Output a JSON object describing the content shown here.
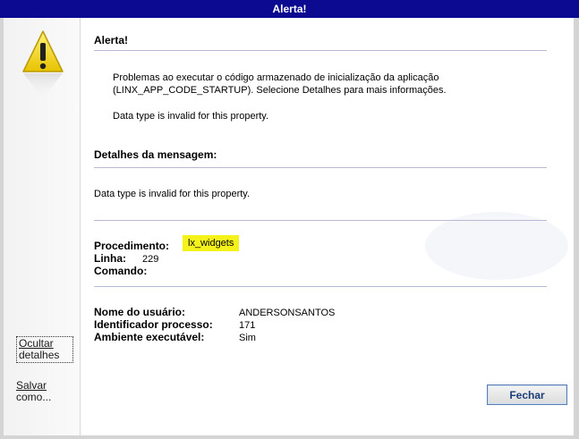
{
  "window": {
    "title": "Alerta!"
  },
  "sidebar": {
    "hide_details_line1": "Ocultar",
    "hide_details_line2": "detalhes",
    "save_as_line1": "Salvar",
    "save_as_line2": "como..."
  },
  "alert": {
    "heading": "Alerta!",
    "message_line1": "Problemas ao executar o código armazenado de inicialização da aplicação",
    "message_line2": "(LINX_APP_CODE_STARTUP). Selecione Detalhes para mais informações.",
    "message_line3": "Data type is invalid for this property."
  },
  "details": {
    "heading": "Detalhes da mensagem:",
    "message": "Data type is invalid for this property.",
    "procedure_label": "Procedimento:",
    "procedure_value": "lx_widgets",
    "line_label": "Linha:",
    "line_value": "229",
    "command_label": "Comando:",
    "command_value": ""
  },
  "session": {
    "user_label": "Nome do usuário:",
    "user_value": "ANDERSONSANTOS",
    "process_label": "Identificador processo:",
    "process_value": "171",
    "env_label": "Ambiente executável:",
    "env_value": "Sim"
  },
  "footer": {
    "close_label": "Fechar"
  },
  "colors": {
    "titlebar": "#0b0a91",
    "highlight": "#f4f21a",
    "rule": "#b9b9d6",
    "warning_yellow": "#f2d500"
  },
  "icons": [
    "warning-icon"
  ]
}
